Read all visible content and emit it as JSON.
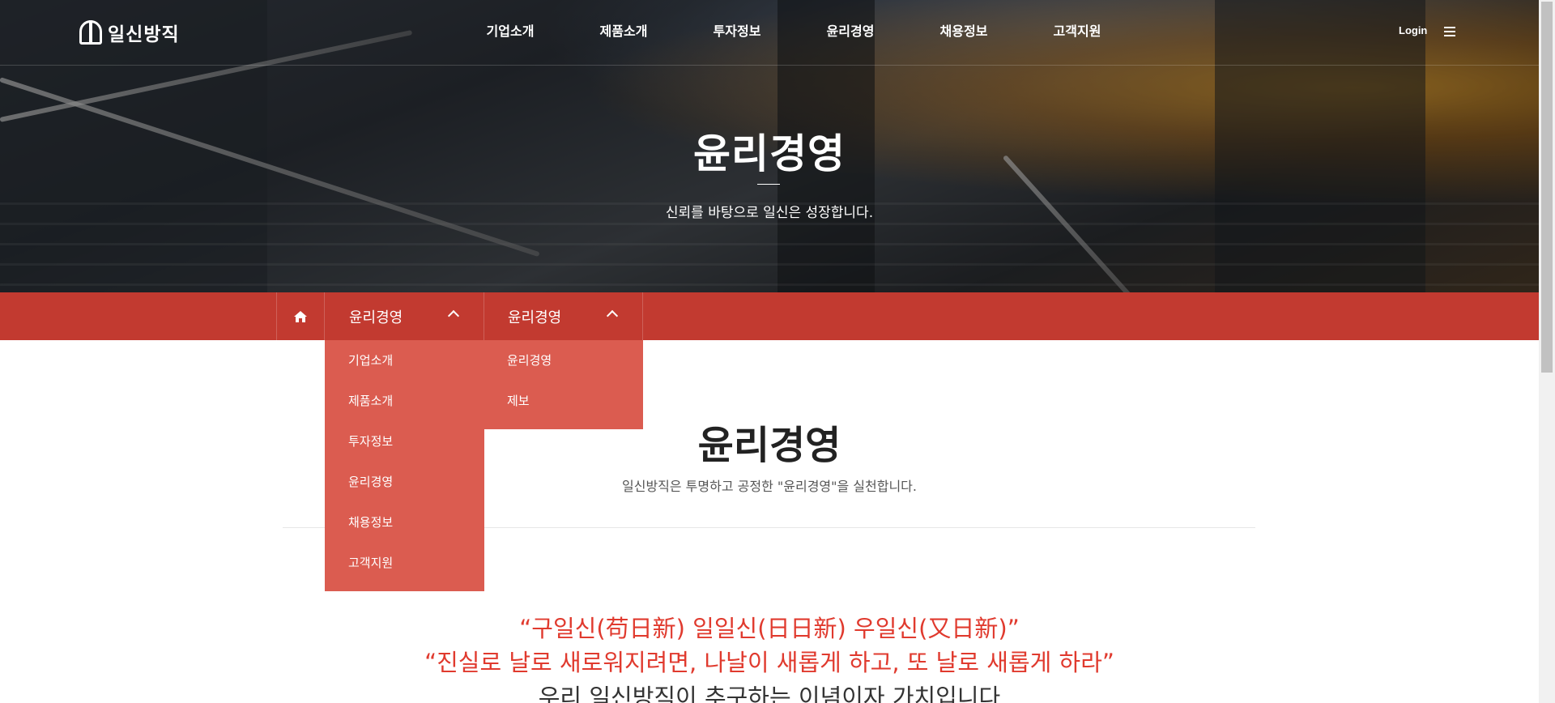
{
  "logo": {
    "text": "일신방직"
  },
  "nav": {
    "items": [
      "기업소개",
      "제품소개",
      "투자정보",
      "윤리경영",
      "채용정보",
      "고객지원"
    ],
    "login_label": "Login"
  },
  "hero": {
    "title": "윤리경영",
    "subtitle": "신뢰를 바탕으로 일신은 성장합니다."
  },
  "subnav": {
    "drop1": {
      "label": "윤리경영",
      "items": [
        "기업소개",
        "제품소개",
        "투자정보",
        "윤리경영",
        "채용정보",
        "고객지원"
      ]
    },
    "drop2": {
      "label": "윤리경영",
      "items": [
        "윤리경영",
        "제보"
      ]
    }
  },
  "content": {
    "title": "윤리경영",
    "subtitle": "일신방직은 투명하고 공정한 \"윤리경영\"을 실천합니다.",
    "quote1": "“구일신(苟日新) 일일신(日日新) 우일신(又日新)”",
    "quote2": "“진실로 날로 새로워지려면, 나날이 새롭게 하고, 또 날로 새롭게 하라”",
    "quote3": "우리 일신방직이 추구하는 이념이자 가치입니다"
  },
  "colors": {
    "subnav_bg": "#c23a30",
    "dropdown_bg": "#db5c50",
    "quote_red": "#e03a2e"
  }
}
